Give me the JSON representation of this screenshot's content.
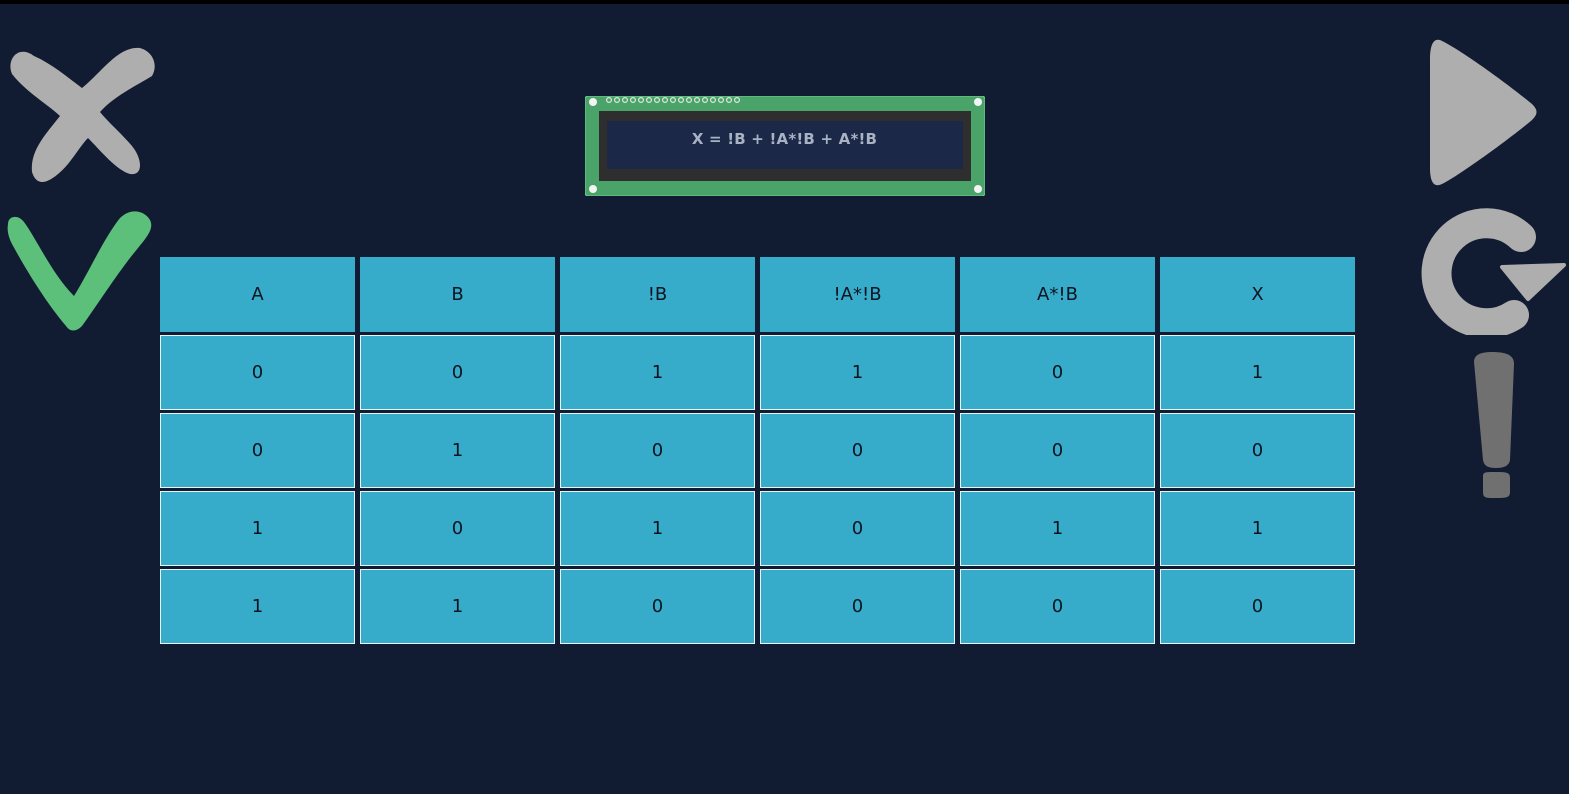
{
  "display": {
    "expression": "X = !B + !A*!B + A*!B"
  },
  "controls": {
    "left": [
      "close-icon",
      "checkmark-icon"
    ],
    "right": [
      "play-icon",
      "restart-icon",
      "hint-icon"
    ]
  },
  "colors": {
    "background": "#111b31",
    "cell": "#37abca",
    "check": "#5cc07a",
    "icon_gray": "#aeaeae",
    "hint_gray": "#707070",
    "lcd_board": "#4aa469",
    "lcd_screen": "#1b2848"
  },
  "table": {
    "headers": [
      "A",
      "B",
      "!B",
      "!A*!B",
      "A*!B",
      "X"
    ],
    "rows": [
      [
        "0",
        "0",
        "1",
        "1",
        "0",
        "1"
      ],
      [
        "0",
        "1",
        "0",
        "0",
        "0",
        "0"
      ],
      [
        "1",
        "0",
        "1",
        "0",
        "1",
        "1"
      ],
      [
        "1",
        "1",
        "0",
        "0",
        "0",
        "0"
      ]
    ]
  }
}
